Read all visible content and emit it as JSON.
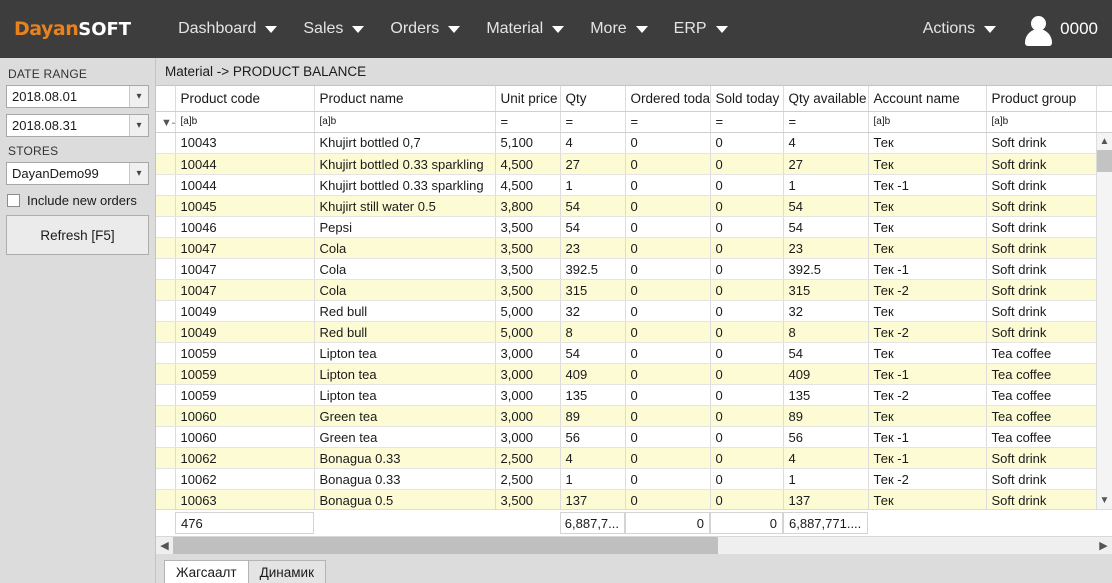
{
  "header": {
    "logo_primary": "Dayan",
    "logo_secondary": "SOFT",
    "nav": [
      {
        "label": "Dashboard",
        "icon": "chevron-down-icon"
      },
      {
        "label": "Sales",
        "icon": "chevron-down-icon"
      },
      {
        "label": "Orders",
        "icon": "chevron-down-icon"
      },
      {
        "label": "Material",
        "icon": "chevron-down-icon"
      },
      {
        "label": "More",
        "icon": "chevron-down-icon"
      },
      {
        "label": "ERP",
        "icon": "chevron-down-icon"
      }
    ],
    "actions_label": "Actions",
    "user_id": "0000",
    "avatar_icon": "user-avatar-icon"
  },
  "sidebar": {
    "date_range_label": "DATE RANGE",
    "date_from": "2018.08.01",
    "date_to": "2018.08.31",
    "stores_label": "STORES",
    "store": "DayanDemo99",
    "include_new_orders_label": "Include new orders",
    "include_new_orders_checked": false,
    "refresh_label": "Refresh [F5]",
    "dropdown_icon": "chevron-down-icon"
  },
  "breadcrumb": "Material -> PRODUCT BALANCE",
  "grid": {
    "columns": [
      "Product code",
      "Product name",
      "Unit price",
      "Qty",
      "Ordered today",
      "Sold today",
      "Qty available",
      "Account name",
      "Product group"
    ],
    "filter_row": [
      "[a]b",
      "[a]b",
      "=",
      "=",
      "=",
      "=",
      "=",
      "[a]b",
      "[a]b"
    ],
    "filter_icon": "funnel-filter-icon",
    "rows": [
      [
        "10043",
        "Khujirt bottled 0,7",
        "5,100",
        "4",
        "0",
        "0",
        "4",
        "Тек",
        "Soft drink"
      ],
      [
        "10044",
        "Khujirt bottled 0.33 sparkling",
        "4,500",
        "27",
        "0",
        "0",
        "27",
        "Тек",
        "Soft drink"
      ],
      [
        "10044",
        "Khujirt bottled 0.33 sparkling",
        "4,500",
        "1",
        "0",
        "0",
        "1",
        "Тек -1",
        "Soft drink"
      ],
      [
        "10045",
        "Khujirt still water 0.5",
        "3,800",
        "54",
        "0",
        "0",
        "54",
        "Тек",
        "Soft drink"
      ],
      [
        "10046",
        "Pepsi",
        "3,500",
        "54",
        "0",
        "0",
        "54",
        "Тек",
        "Soft drink"
      ],
      [
        "10047",
        "Cola",
        "3,500",
        "23",
        "0",
        "0",
        "23",
        "Тек",
        "Soft drink"
      ],
      [
        "10047",
        "Cola",
        "3,500",
        "392.5",
        "0",
        "0",
        "392.5",
        "Тек -1",
        "Soft drink"
      ],
      [
        "10047",
        "Cola",
        "3,500",
        "315",
        "0",
        "0",
        "315",
        "Тек -2",
        "Soft drink"
      ],
      [
        "10049",
        "Red bull",
        "5,000",
        "32",
        "0",
        "0",
        "32",
        "Тек",
        "Soft drink"
      ],
      [
        "10049",
        "Red bull",
        "5,000",
        "8",
        "0",
        "0",
        "8",
        "Тек -2",
        "Soft drink"
      ],
      [
        "10059",
        "Lipton tea",
        "3,000",
        "54",
        "0",
        "0",
        "54",
        "Тек",
        "Tea coffee"
      ],
      [
        "10059",
        "Lipton tea",
        "3,000",
        "409",
        "0",
        "0",
        "409",
        "Тек -1",
        "Tea coffee"
      ],
      [
        "10059",
        "Lipton tea",
        "3,000",
        "135",
        "0",
        "0",
        "135",
        "Тек -2",
        "Tea coffee"
      ],
      [
        "10060",
        "Green tea",
        "3,000",
        "89",
        "0",
        "0",
        "89",
        "Тек",
        "Tea coffee"
      ],
      [
        "10060",
        "Green tea",
        "3,000",
        "56",
        "0",
        "0",
        "56",
        "Тек -1",
        "Tea coffee"
      ],
      [
        "10062",
        "Bonagua 0.33",
        "2,500",
        "4",
        "0",
        "0",
        "4",
        "Тек -1",
        "Soft drink"
      ],
      [
        "10062",
        "Bonagua 0.33",
        "2,500",
        "1",
        "0",
        "0",
        "1",
        "Тек -2",
        "Soft drink"
      ],
      [
        "10063",
        "Bonagua 0.5",
        "3,500",
        "137",
        "0",
        "0",
        "137",
        "Тек",
        "Soft drink"
      ]
    ],
    "summary": {
      "product_code_count": "476",
      "qty_total": "6,887,7...",
      "ordered_today_total": "0",
      "sold_today_total": "0",
      "qty_available_total": "6,887,771...."
    },
    "scroll_up_icon": "chevron-up-icon",
    "scroll_down_icon": "chevron-down-icon",
    "scroll_left_icon": "chevron-left-icon",
    "scroll_right_icon": "chevron-right-icon"
  },
  "tabs": [
    {
      "label": "Жагсаалт",
      "active": true
    },
    {
      "label": "Динамик",
      "active": false
    }
  ],
  "colors": {
    "topbar": "#3d3d3d",
    "logo_accent": "#e8821e",
    "panel": "#dcdcdc",
    "row_alt": "#fdfbd4"
  }
}
